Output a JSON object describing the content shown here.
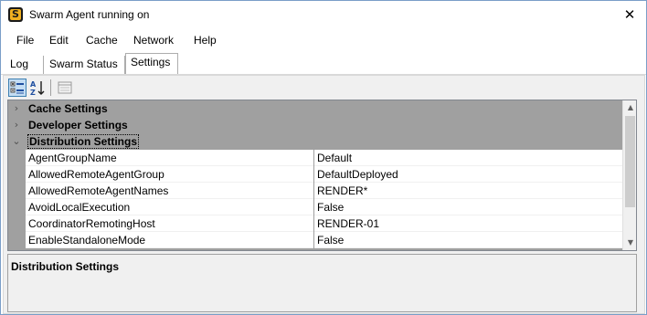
{
  "window": {
    "title": "Swarm Agent running on",
    "close_glyph": "✕",
    "icon": "swarm-agent-app-icon",
    "icon_letter": "S"
  },
  "menu": {
    "items": [
      "File",
      "Edit",
      "Cache",
      "Network",
      "Help"
    ]
  },
  "tabs": {
    "items": [
      "Log",
      "Swarm Status",
      "Settings"
    ],
    "active": "Settings"
  },
  "toolbar": {
    "buttons": [
      "categorized-view-icon",
      "alphabetical-sort-icon",
      "property-pages-icon"
    ],
    "alpha_glyph_a": "A",
    "alpha_glyph_z": "Z"
  },
  "property_grid": {
    "categories": [
      {
        "label": "Cache Settings",
        "expanded": false
      },
      {
        "label": "Developer Settings",
        "expanded": false
      },
      {
        "label": "Distribution Settings",
        "expanded": true
      }
    ],
    "collapsed_glyph": "›",
    "expanded_glyph": "⌄",
    "properties": [
      {
        "name": "AgentGroupName",
        "value": "Default"
      },
      {
        "name": "AllowedRemoteAgentGroup",
        "value": "DefaultDeployed"
      },
      {
        "name": "AllowedRemoteAgentNames",
        "value": "RENDER*"
      },
      {
        "name": "AvoidLocalExecution",
        "value": "False"
      },
      {
        "name": "CoordinatorRemotingHost",
        "value": "RENDER-01"
      },
      {
        "name": "EnableStandaloneMode",
        "value": "False"
      }
    ],
    "scroll_up_glyph": "▲",
    "scroll_down_glyph": "▼"
  },
  "description": {
    "title": "Distribution Settings"
  },
  "colors": {
    "category_bg": "#a0a0a0",
    "grid_bg": "#f0f0f0",
    "window_border": "#7a9ec8",
    "icon_yellow": "#f0b020"
  }
}
